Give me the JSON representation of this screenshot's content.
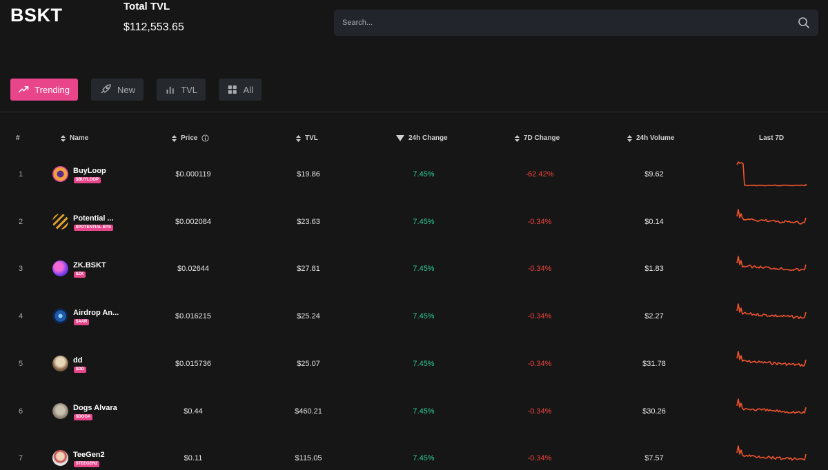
{
  "brand": {
    "logo": "BSKT"
  },
  "tvl": {
    "label": "Total TVL",
    "value": "$112,553.65"
  },
  "search": {
    "placeholder": "Search..."
  },
  "filters": [
    {
      "label": "Trending",
      "icon": "trending-up-icon",
      "active": true
    },
    {
      "label": "New",
      "icon": "rocket-icon",
      "active": false
    },
    {
      "label": "TVL",
      "icon": "bar-chart-icon",
      "active": false
    },
    {
      "label": "All",
      "icon": "grid-icon",
      "active": false
    }
  ],
  "table": {
    "columns": {
      "rank": "#",
      "name": "Name",
      "price": "Price",
      "tvl": "TVL",
      "change24h": "24h Change",
      "change7d": "7D Change",
      "volume24h": "24h Volume",
      "last7d": "Last 7D"
    },
    "rows": [
      {
        "rank": "1",
        "name": "BuyLoop",
        "ticker": "$BUYLOOP",
        "price": "$0.000119",
        "tvl": "$19.86",
        "change24h": "7.45%",
        "change7d": "-62.42%",
        "volume": "$9.62"
      },
      {
        "rank": "2",
        "name": "Potential ...",
        "ticker": "$POTENTIAL BTS",
        "price": "$0.002084",
        "tvl": "$23.63",
        "change24h": "7.45%",
        "change7d": "-0.34%",
        "volume": "$0.14"
      },
      {
        "rank": "3",
        "name": "ZK.BSKT",
        "ticker": "$ZK",
        "price": "$0.02644",
        "tvl": "$27.81",
        "change24h": "7.45%",
        "change7d": "-0.34%",
        "volume": "$1.83"
      },
      {
        "rank": "4",
        "name": "Airdrop An...",
        "ticker": "$AAR",
        "price": "$0.016215",
        "tvl": "$25.24",
        "change24h": "7.45%",
        "change7d": "-0.34%",
        "volume": "$2.27"
      },
      {
        "rank": "5",
        "name": "dd",
        "ticker": "$DD",
        "price": "$0.015736",
        "tvl": "$25.07",
        "change24h": "7.45%",
        "change7d": "-0.34%",
        "volume": "$31.78"
      },
      {
        "rank": "6",
        "name": "Dogs Alvara",
        "ticker": "$DOGA",
        "price": "$0.44",
        "tvl": "$460.21",
        "change24h": "7.45%",
        "change7d": "-0.34%",
        "volume": "$30.26"
      },
      {
        "rank": "7",
        "name": "TeeGen2",
        "ticker": "$TEEGEN2",
        "price": "$0.11",
        "tvl": "$115.05",
        "change24h": "7.45%",
        "change7d": "-0.34%",
        "volume": "$7.57"
      }
    ]
  },
  "colors": {
    "accent": "#e8458b",
    "positive": "#2ecb94",
    "negative": "#f2453d",
    "sparkline": "#f2542d"
  }
}
